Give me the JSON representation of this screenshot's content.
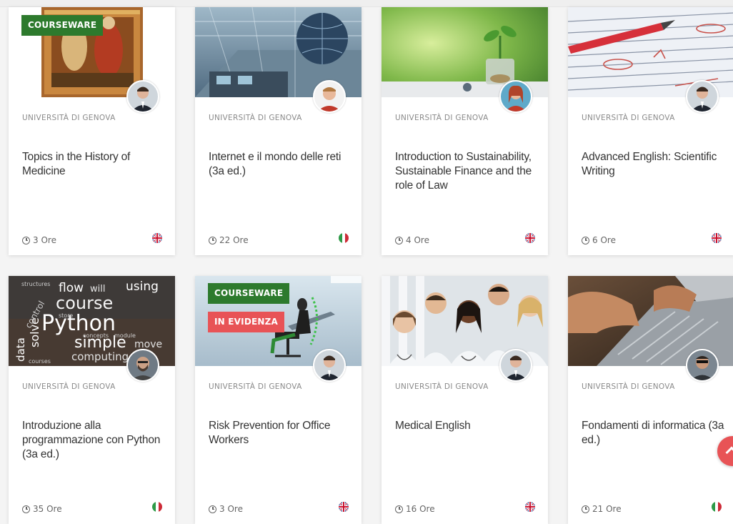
{
  "courses": [
    {
      "institution": "UNIVERSITÀ DI GENOVA",
      "title": "Topics in the History of Medicine",
      "duration": "3 Ore",
      "language_flag": "uk-flag-icon",
      "badges": [
        "COURSEWARE"
      ]
    },
    {
      "institution": "UNIVERSITÀ DI GENOVA",
      "title": "Internet e il mondo delle reti (3a ed.)",
      "duration": "22 Ore",
      "language_flag": "italy-flag-icon",
      "badges": []
    },
    {
      "institution": "UNIVERSITÀ DI GENOVA",
      "title": "Introduction to Sustainability, Sustainable Finance and the role of Law",
      "duration": "4 Ore",
      "language_flag": "uk-flag-icon",
      "badges": []
    },
    {
      "institution": "UNIVERSITÀ DI GENOVA",
      "title": "Advanced English: Scientific Writing",
      "duration": "6 Ore",
      "language_flag": "uk-flag-icon",
      "badges": []
    },
    {
      "institution": "UNIVERSITÀ DI GENOVA",
      "title": "Introduzione alla programmazione con Python (3a ed.)",
      "duration": "35 Ore",
      "language_flag": "italy-flag-icon",
      "badges": []
    },
    {
      "institution": "UNIVERSITÀ DI GENOVA",
      "title": "Risk Prevention for Office Workers",
      "duration": "3 Ore",
      "language_flag": "uk-flag-icon",
      "badges": [
        "COURSEWARE",
        "IN EVIDENZA"
      ]
    },
    {
      "institution": "UNIVERSITÀ DI GENOVA",
      "title": "Medical English",
      "duration": "16 Ore",
      "language_flag": "uk-flag-icon",
      "badges": []
    },
    {
      "institution": "UNIVERSITÀ DI GENOVA",
      "title": "Fondamenti di informatica (3a ed.)",
      "duration": "21 Ore",
      "language_flag": "italy-flag-icon",
      "badges": []
    }
  ],
  "python_wordcloud": [
    "flow",
    "will",
    "using",
    "course",
    "Python",
    "simple",
    "move",
    "computing",
    "solve",
    "data",
    "control",
    "structures",
    "store",
    "concepts",
    "module",
    "courses"
  ],
  "colors": {
    "courseware_badge": "#2d7a2d",
    "featured_badge": "#e85356",
    "scroll_top_button": "#e85356"
  },
  "icons": {
    "duration": "clock-icon",
    "scroll_top": "chevron-up-icon"
  }
}
